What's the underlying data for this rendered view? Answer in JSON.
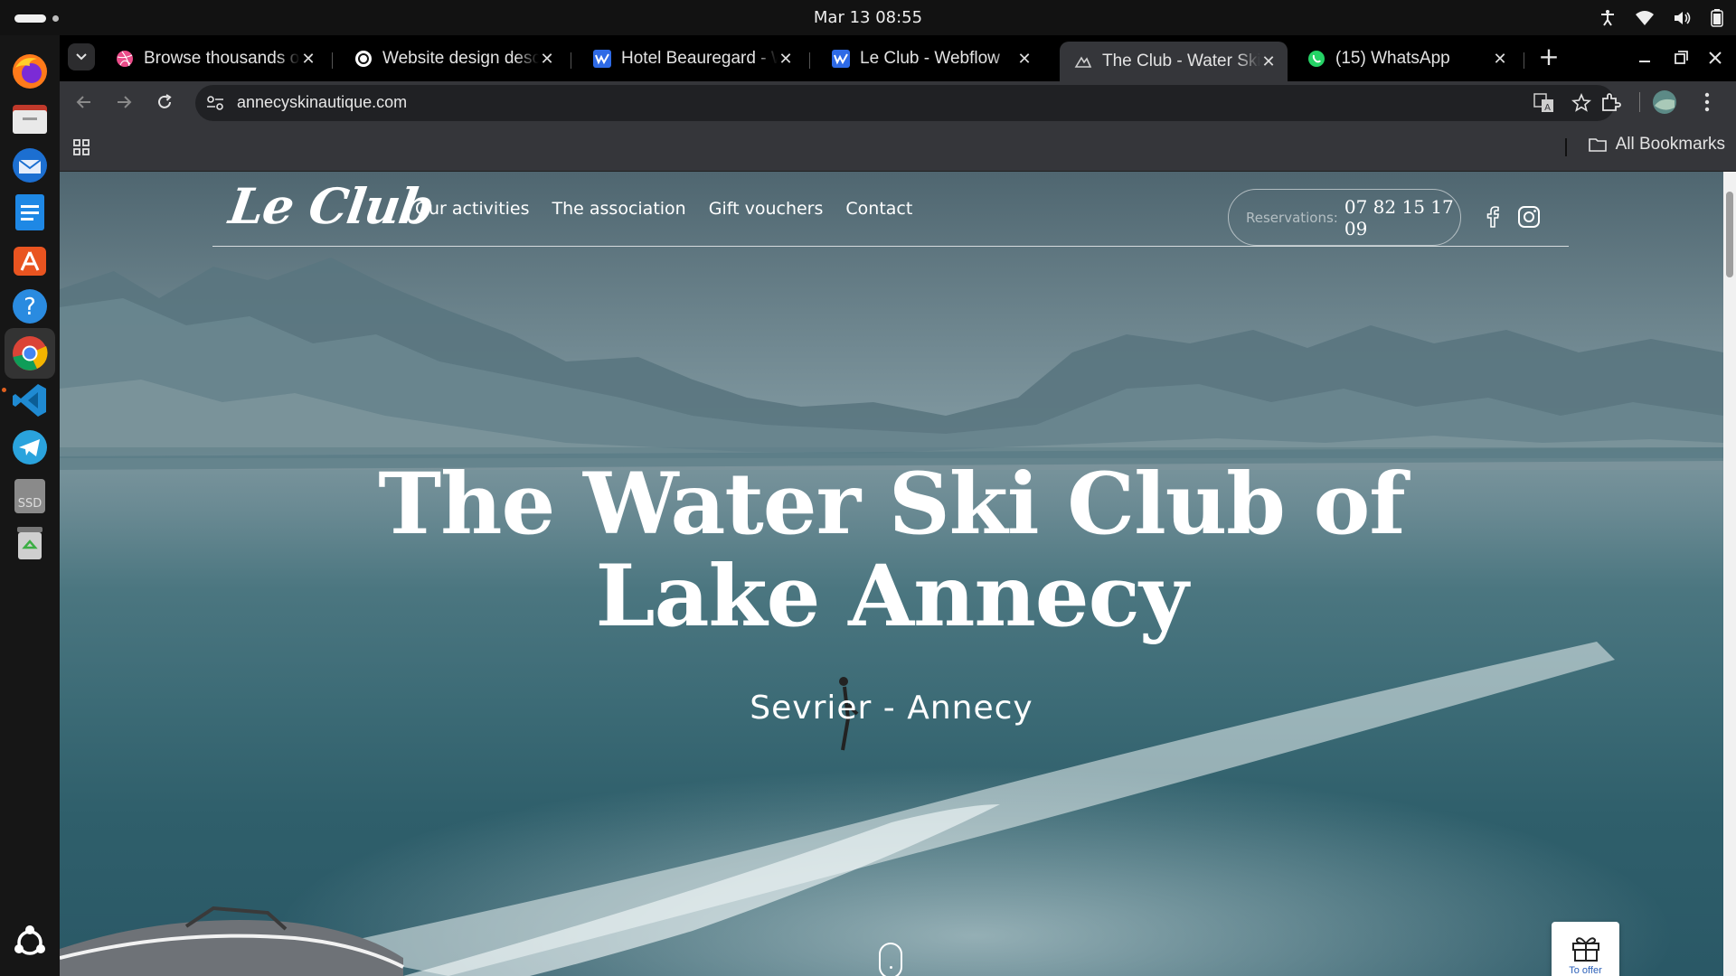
{
  "system": {
    "clock": "Mar 13  08:55"
  },
  "browser": {
    "tabs": [
      {
        "title": "Browse thousands of",
        "favicon": "dribbble-icon"
      },
      {
        "title": "Website design desc",
        "favicon": "openai-icon"
      },
      {
        "title": "Hotel Beauregard - W",
        "favicon": "webflow-icon"
      },
      {
        "title": "Le Club - Webflow",
        "favicon": "webflow-icon"
      },
      {
        "title": "The Club - Water Ski",
        "favicon": "ski-icon",
        "active": true
      },
      {
        "title": "(15) WhatsApp",
        "favicon": "whatsapp-icon"
      }
    ],
    "close_glyph": "✕",
    "new_tab_glyph": "+",
    "url": "annecyskinautique.com",
    "bookmarks_label": "All Bookmarks"
  },
  "site": {
    "logo": "Le Club",
    "menu": [
      "Our activities",
      "The association",
      "Gift vouchers",
      "Contact"
    ],
    "reservations_label": "Reservations:",
    "reservations_phone": "07 82 15 17 09",
    "hero_title_line1": "The Water Ski Club of",
    "hero_title_line2": "Lake Annecy",
    "hero_subtitle": "Sevrier - Annecy",
    "gift_label": "To offer"
  },
  "colors": {
    "accent_blue": "#2a5fb8",
    "chrome_bg": "#35363a",
    "tabstrip_bg": "#000000"
  }
}
